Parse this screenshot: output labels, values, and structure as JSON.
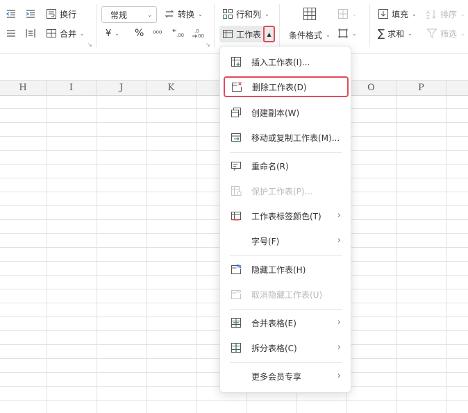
{
  "ribbon": {
    "wrap_text": "换行",
    "merge": "合并",
    "number_format": "常规",
    "convert": "转换",
    "currency_symbol": "¥",
    "percent_symbol": "%",
    "thousands_symbol": "⁰⁰⁰",
    "rows_cols": "行和列",
    "worksheet": "工作表",
    "cond_format": "条件格式",
    "fill": "填充",
    "sort": "排序",
    "sum": "求和",
    "filter": "筛选"
  },
  "columns": [
    "H",
    "I",
    "J",
    "K",
    "O",
    "P"
  ],
  "menu": {
    "items": [
      {
        "label": "插入工作表(I)...",
        "icon": "insert-sheet-icon",
        "enabled": true
      },
      {
        "label": "删除工作表(D)",
        "icon": "delete-sheet-icon",
        "enabled": true,
        "highlighted": true
      },
      {
        "label": "创建副本(W)",
        "icon": "copy-sheet-icon",
        "enabled": true
      },
      {
        "label": "移动或复制工作表(M)...",
        "icon": "move-copy-sheet-icon",
        "enabled": true
      },
      {
        "label": "重命名(R)",
        "icon": "rename-icon",
        "enabled": true
      },
      {
        "label": "保护工作表(P)...",
        "icon": "protect-sheet-icon",
        "enabled": false
      },
      {
        "label": "工作表标签颜色(T)",
        "icon": "tab-color-icon",
        "enabled": true,
        "submenu": true
      },
      {
        "label": "字号(F)",
        "icon": "",
        "enabled": true,
        "submenu": true
      },
      {
        "label": "隐藏工作表(H)",
        "icon": "hide-sheet-icon",
        "enabled": true
      },
      {
        "label": "取消隐藏工作表(U)",
        "icon": "unhide-sheet-icon",
        "enabled": false
      },
      {
        "label": "合并表格(E)",
        "icon": "merge-tables-icon",
        "enabled": true,
        "submenu": true
      },
      {
        "label": "拆分表格(C)",
        "icon": "split-table-icon",
        "enabled": true,
        "submenu": true
      },
      {
        "label": "更多会员专享",
        "icon": "",
        "enabled": true,
        "submenu": true
      }
    ]
  },
  "colors": {
    "highlight": "#e04b5a",
    "icon_accent": "#2a8a5c",
    "grid_line": "#e2e2e2"
  }
}
